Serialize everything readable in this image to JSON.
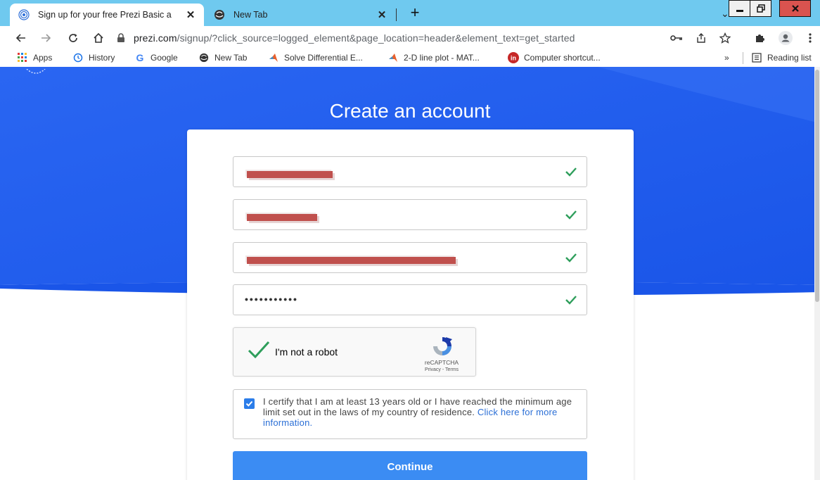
{
  "browser": {
    "tabs": [
      {
        "title": "Sign up for your free Prezi Basic a",
        "active": true
      },
      {
        "title": "New Tab",
        "active": false
      }
    ],
    "new_tab_label": "+",
    "address": {
      "host": "prezi.com",
      "path": "/signup/?click_source=logged_element&page_location=header&element_text=get_started"
    },
    "bookmarks": [
      {
        "label": "Apps",
        "icon": "apps-grid-icon"
      },
      {
        "label": "History",
        "icon": "history-icon"
      },
      {
        "label": "Google",
        "icon": "google-icon"
      },
      {
        "label": "New Tab",
        "icon": "globe-icon"
      },
      {
        "label": "Solve Differential E...",
        "icon": "matlab-icon"
      },
      {
        "label": "2-D line plot - MAT...",
        "icon": "matlab-icon"
      },
      {
        "label": "Computer shortcut...",
        "icon": "linkedin-icon"
      }
    ],
    "overflow_label": "»",
    "reading_list_label": "Reading list"
  },
  "page": {
    "title": "Create an account",
    "password_mask": "•••••••••••",
    "captcha": {
      "label": "I'm not a robot",
      "brand": "reCAPTCHA",
      "links": "Privacy - Terms"
    },
    "consent": {
      "text": "I certify that I am at least 13 years old or I have reached the minimum age limit set out in the laws of my country of residence.",
      "link": "Click here for more information.",
      "checked": true
    },
    "continue_label": "Continue"
  },
  "colors": {
    "hero_blue": "#1f5df0",
    "button_blue": "#3b8cf3",
    "check_green": "#2e9e5b",
    "tab_strip": "#6fc9ef"
  }
}
